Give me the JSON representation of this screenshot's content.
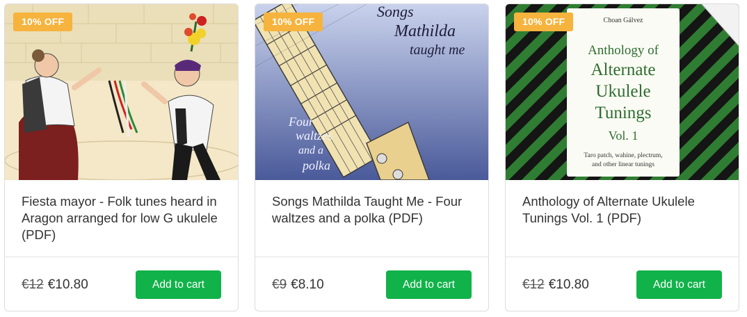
{
  "products": [
    {
      "badge": "10% OFF",
      "title": "Fiesta mayor - Folk tunes heard in Aragon arranged for low G ukulele (PDF)",
      "old_price": "€12",
      "price": "€10.80",
      "cart_label": "Add to cart"
    },
    {
      "badge": "10% OFF",
      "title": "Songs Mathilda Taught Me - Four waltzes and a polka (PDF)",
      "old_price": "€9",
      "price": "€8.10",
      "cart_label": "Add to cart",
      "cover": {
        "title_line1": "Songs",
        "title_line2": "Mathilda",
        "title_line3": "taught me",
        "sub_line1": "Four",
        "sub_line2": "waltzes",
        "sub_line3": "and a",
        "sub_line4": "polka"
      }
    },
    {
      "badge": "10% OFF",
      "title": "Anthology of Alternate Ukulele Tunings Vol. 1 (PDF)",
      "old_price": "€12",
      "price": "€10.80",
      "cart_label": "Add to cart",
      "cover": {
        "author": "Choan Gálvez",
        "line1": "Anthology of",
        "line2": "Alternate",
        "line3": "Ukulele",
        "line4": "Tunings",
        "line5": "Vol. 1",
        "sub1": "Taro patch, wahine, plectrum,",
        "sub2": "and other linear tunings"
      }
    }
  ],
  "colors": {
    "badge": "#f6b33d",
    "button": "#12b24a",
    "stripe_green": "#2f7d32"
  }
}
